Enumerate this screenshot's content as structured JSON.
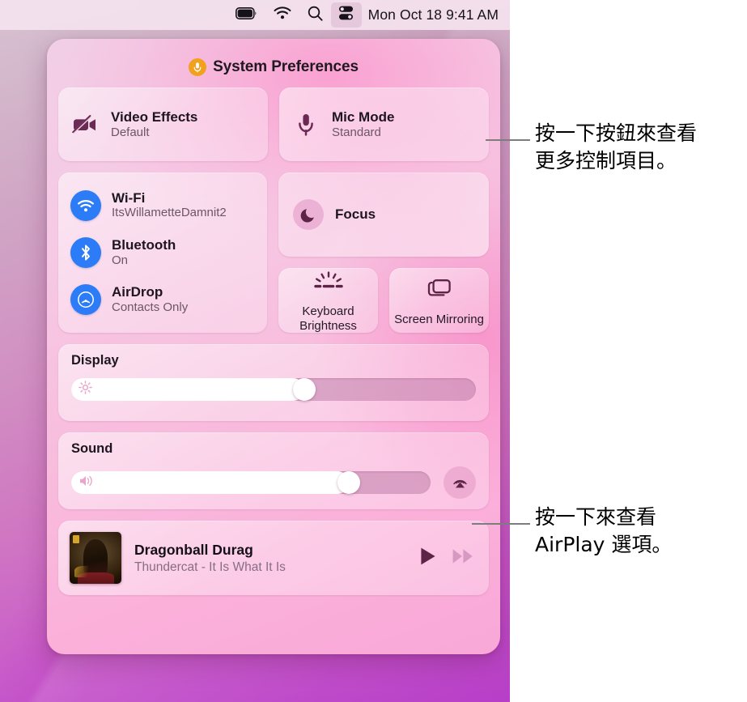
{
  "menubar": {
    "items": [
      {
        "name": "battery-icon",
        "label": "Battery"
      },
      {
        "name": "wifi-icon",
        "label": "Wi-Fi"
      },
      {
        "name": "spotlight-search-icon",
        "label": "Spotlight Search"
      },
      {
        "name": "control-center-icon",
        "label": "Control Center"
      }
    ],
    "clock": "Mon Oct 18  9:41 AM"
  },
  "control_center": {
    "header": {
      "title": "System Preferences",
      "badge_icon": "microphone-icon"
    },
    "av_tiles": [
      {
        "icon": "video-camera-off-icon",
        "title": "Video Effects",
        "subtitle": "Default"
      },
      {
        "icon": "microphone-icon",
        "title": "Mic Mode",
        "subtitle": "Standard"
      }
    ],
    "network": [
      {
        "icon": "wifi-icon",
        "title": "Wi-Fi",
        "subtitle": "ItsWillametteDamnit2"
      },
      {
        "icon": "bluetooth-icon",
        "title": "Bluetooth",
        "subtitle": "On"
      },
      {
        "icon": "airdrop-icon",
        "title": "AirDrop",
        "subtitle": "Contacts Only"
      }
    ],
    "focus": {
      "icon": "moon-icon",
      "label": "Focus"
    },
    "mini_tiles": [
      {
        "icon": "keyboard-brightness-icon",
        "label": "Keyboard\nBrightness"
      },
      {
        "icon": "screen-mirroring-icon",
        "label": "Screen\nMirroring"
      }
    ],
    "display_slider": {
      "title": "Display",
      "icon": "brightness-icon",
      "value_percent": 58
    },
    "sound_slider": {
      "title": "Sound",
      "icon": "speaker-icon",
      "value_percent": 79,
      "airplay_button_icon": "airplay-audio-icon"
    },
    "now_playing": {
      "artwork_name": "album-artwork",
      "track": "Dragonball Durag",
      "artist_album": "Thundercat - It Is What It Is",
      "controls": [
        {
          "icon": "play-icon",
          "label": "Play"
        },
        {
          "icon": "fast-forward-icon",
          "label": "Fast Forward"
        }
      ]
    }
  },
  "annotations": [
    {
      "text": "按一下按鈕來查看\n更多控制項目。"
    },
    {
      "text": "按一下來查看\nAirPlay 選項。"
    }
  ],
  "colors": {
    "accent_blue": "#2b7cf6",
    "badge_orange": "#f0a11e",
    "panel_pink": "#f8bcdd",
    "leader_gray": "#7d7d7d",
    "icon_plum": "#6b2a54"
  }
}
